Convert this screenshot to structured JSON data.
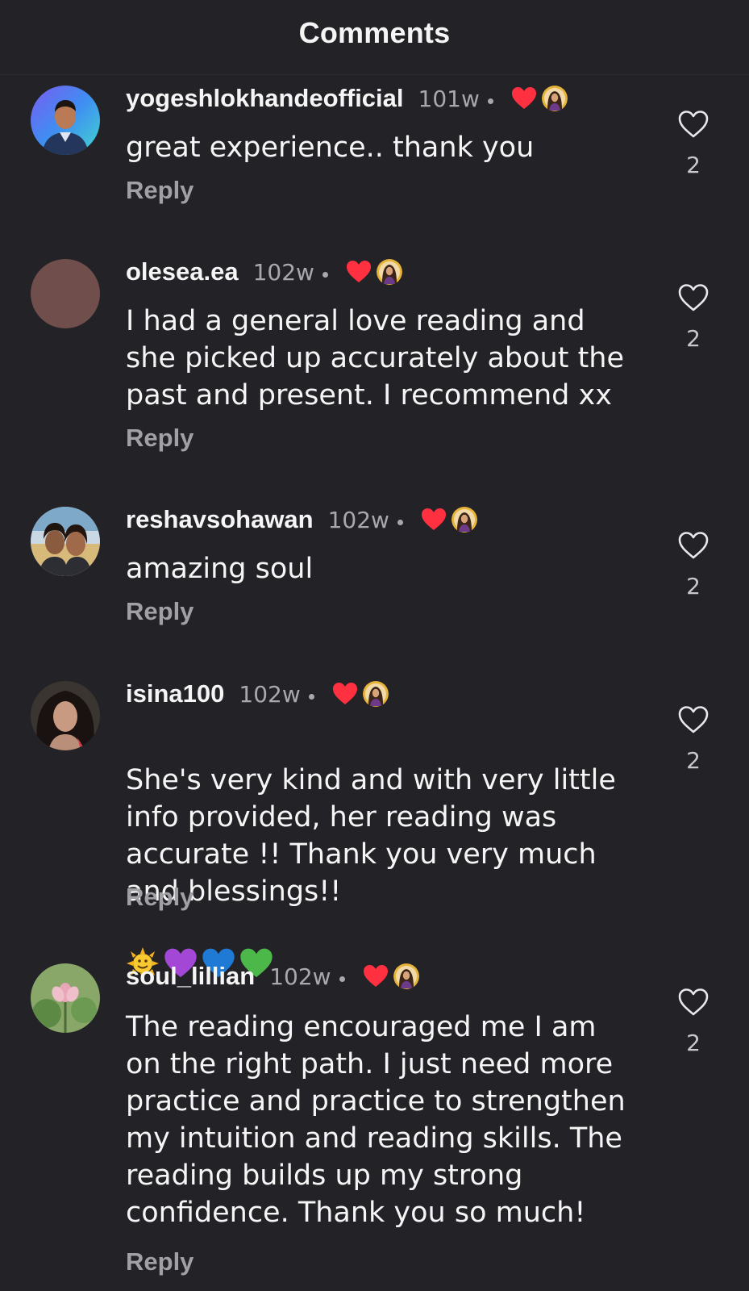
{
  "header": {
    "title": "Comments"
  },
  "reply_label": "Reply",
  "colors": {
    "background": "#222227",
    "heart_red": "#ff3040",
    "muted_text": "#a8a8ad"
  },
  "icons": {
    "creator_heart": "red-heart-icon",
    "like": "heart-outline-icon"
  },
  "comments": [
    {
      "username": "yogeshlokhandeofficial",
      "time": "101w",
      "text": "great experience.. thank you",
      "likes": "2"
    },
    {
      "username": "olesea.ea",
      "time": "102w",
      "text": "I had a general love reading and\nshe picked up accurately about the\npast and present. I recommend xx",
      "likes": "2"
    },
    {
      "username": "reshavsohawan",
      "time": "102w",
      "text": "amazing soul",
      "likes": "2"
    },
    {
      "username": "isina100",
      "time": "102w",
      "text": "She's very kind and with very little\ninfo provided, her reading was\naccurate !! Thank you very much\nand blessings!!",
      "emojis": [
        "sun-with-face-emoji",
        "purple-heart-emoji",
        "blue-heart-emoji",
        "green-heart-emoji"
      ],
      "likes": "2"
    },
    {
      "username": "soul_lillian",
      "time": "102w",
      "text": "The reading encouraged me I am\non the right path. I just need more\npractice and practice to strengthen\nmy intuition and reading skills. The\nreading builds up my strong\nconfidence. Thank you so much!",
      "likes": "2"
    }
  ]
}
